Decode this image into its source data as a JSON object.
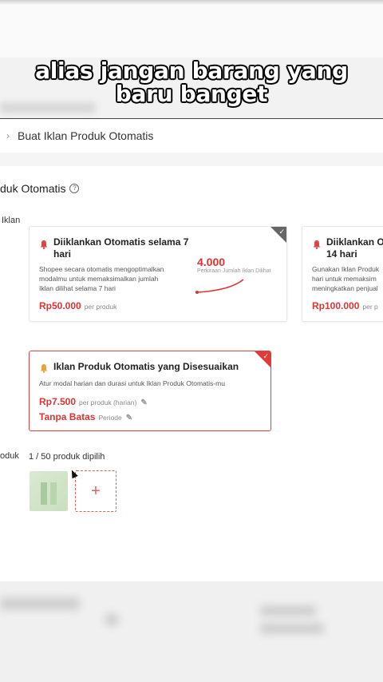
{
  "caption": {
    "line1": "alias jangan barang yang",
    "line2": "baru banget"
  },
  "breadcrumb": {
    "label": "Buat Iklan Produk Otomatis"
  },
  "section": {
    "title": "duk Otomatis",
    "iklan_label": "Iklan",
    "produk_label": "oduk"
  },
  "cards": {
    "seven_day": {
      "title_line1": "Diiklankan Otomatis selama 7",
      "title_line2": "hari",
      "desc_line1": "Shopee secara otomatis mengoptimalkan",
      "desc_line2": "modalmu untuk memaksimalkan jumlah",
      "desc_line3": "Iklan dilihat selama 7 hari",
      "price": "Rp50.000",
      "unit": "per produk",
      "metric_value": "4.000",
      "metric_label": "Perkiraan Jumlah Iklan Dilihat"
    },
    "fourteen_day": {
      "title_line1": "Diiklankan Ot",
      "title_line2": "14 hari",
      "desc_line1": "Gunakan Iklan Produk",
      "desc_line2": "hari untuk memaksim",
      "desc_line3": "meningkatkan penjual",
      "price": "Rp100.000",
      "unit": "per p"
    },
    "custom": {
      "title": "Iklan Produk Otomatis yang Disesuaikan",
      "desc": "Atur modal harian dan durasi untuk Iklan Produk Otomatis-mu",
      "price": "Rp7.500",
      "price_unit": "per produk (harian)",
      "period": "Tanpa Batas",
      "period_unit": "Periode"
    }
  },
  "products": {
    "count_text": "1 / 50 produk dipilih"
  },
  "colors": {
    "accent": "#d33333",
    "selected_border": "#dd4444"
  },
  "icons": [
    "bell-icon",
    "help-icon",
    "check-icon",
    "pencil-icon",
    "plus-icon",
    "chevron-right-icon",
    "cursor-icon"
  ]
}
